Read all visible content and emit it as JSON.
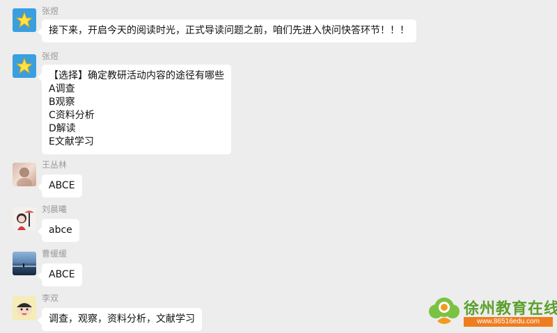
{
  "messages": [
    {
      "sender": "张煜",
      "lines": [
        "接下来，开启今天的阅读时光，正式导读问题之前，咱们先进入快问快答环节！！！"
      ]
    },
    {
      "sender": "张煜",
      "lines": [
        "【选择】确定教研活动内容的途径有哪些",
        "A调查",
        "B观察",
        "C资料分析",
        "D解读",
        "E文献学习"
      ]
    },
    {
      "sender": "王丛林",
      "lines": [
        "ABCE"
      ]
    },
    {
      "sender": "刘晨曦",
      "lines": [
        "abce"
      ]
    },
    {
      "sender": "曹缓缓",
      "lines": [
        "ABCE"
      ]
    },
    {
      "sender": "李双",
      "lines": [
        "调查，观察，资料分析，文献学习"
      ]
    }
  ],
  "watermark": {
    "title": "徐州教育在线",
    "url": "www.86516edu.com"
  }
}
